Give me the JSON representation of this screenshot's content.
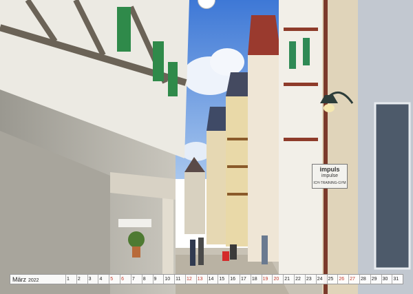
{
  "calendar": {
    "month": "März",
    "year": "2022",
    "days": [
      "1",
      "2",
      "3",
      "4",
      "5",
      "6",
      "7",
      "8",
      "9",
      "10",
      "11",
      "12",
      "13",
      "14",
      "15",
      "16",
      "17",
      "18",
      "19",
      "20",
      "21",
      "22",
      "23",
      "24",
      "25",
      "26",
      "27",
      "28",
      "29",
      "30",
      "31"
    ],
    "sundays": [
      "6",
      "13",
      "20",
      "27"
    ],
    "saturdays": [
      "5",
      "12",
      "19",
      "26"
    ]
  },
  "sign": {
    "line1": "impuls",
    "line2": "impulse",
    "line3": "ICH-TRAINING-GYM"
  },
  "colors": {
    "sky": "#5b8fd8",
    "sunday_text": "#c0392b"
  }
}
